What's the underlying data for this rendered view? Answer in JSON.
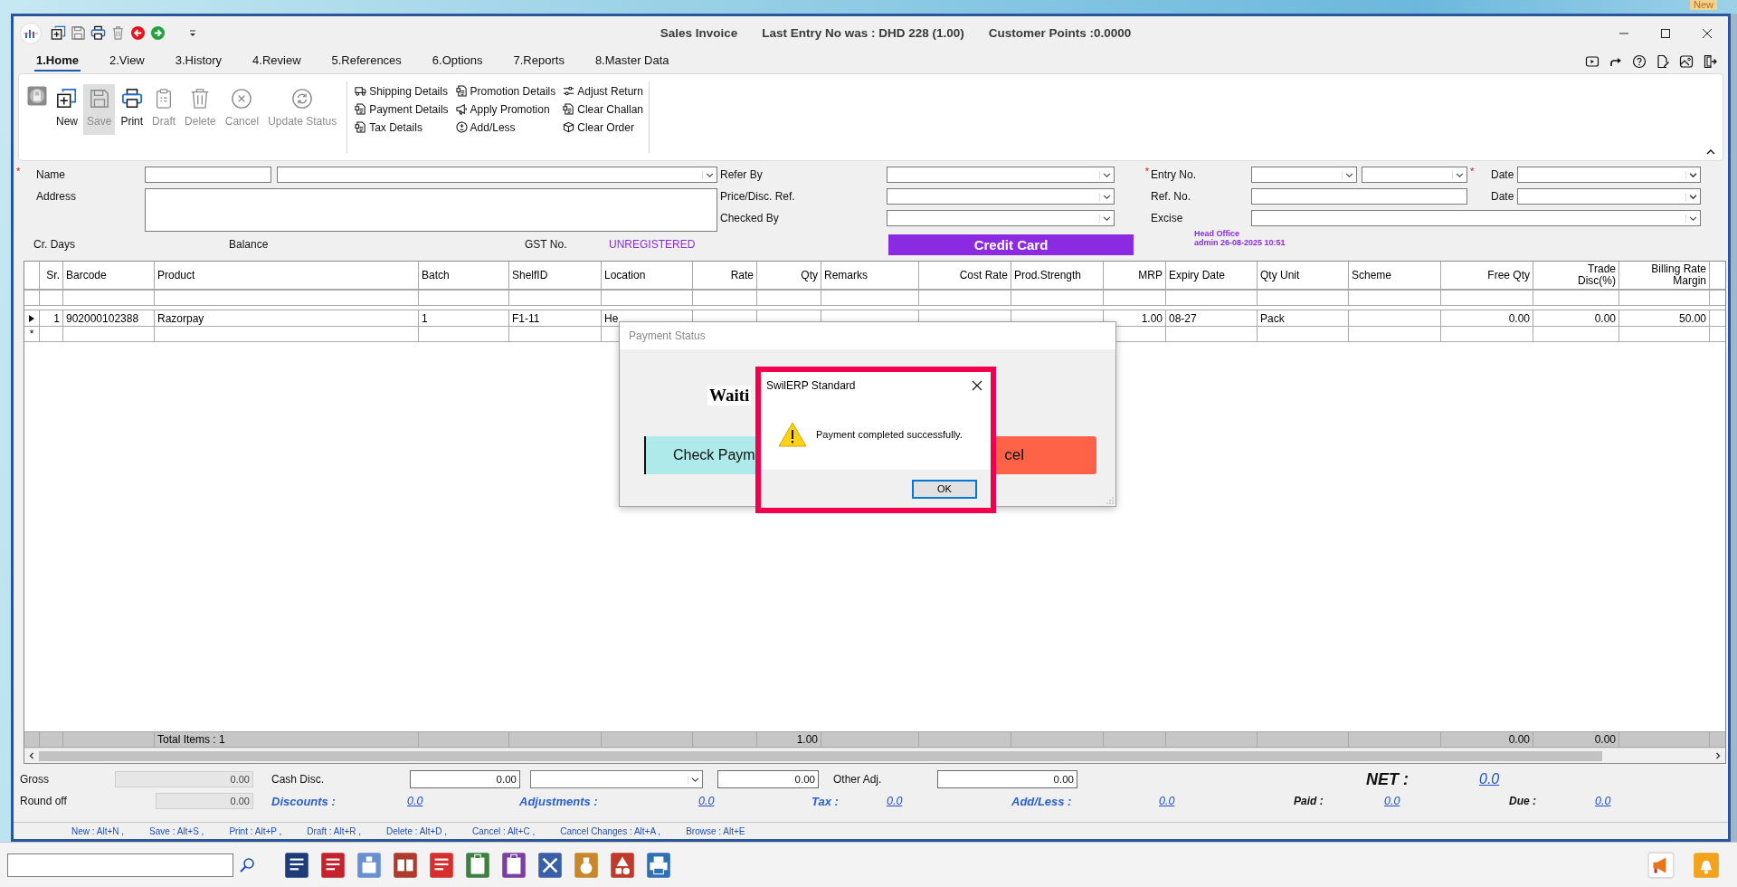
{
  "desktop": {
    "badge": "New"
  },
  "window": {
    "title": "Sales Invoice",
    "last_entry": "Last Entry No was : DHD 228 (1.00)",
    "customer_points": "Customer Points :0.0000"
  },
  "tabs": [
    {
      "label": "1.Home",
      "selected": true
    },
    {
      "label": "2.View",
      "selected": false
    },
    {
      "label": "3.History",
      "selected": false
    },
    {
      "label": "4.Review",
      "selected": false
    },
    {
      "label": "5.References",
      "selected": false
    },
    {
      "label": "6.Options",
      "selected": false
    },
    {
      "label": "7.Reports",
      "selected": false
    },
    {
      "label": "8.Master Data",
      "selected": false
    }
  ],
  "ribbon": {
    "actions": [
      {
        "kind": "new",
        "label": "New",
        "disabled": false,
        "highlighted": false
      },
      {
        "kind": "save",
        "label": "Save",
        "disabled": true,
        "highlighted": true
      },
      {
        "kind": "print",
        "label": "Print",
        "disabled": false,
        "highlighted": false
      },
      {
        "kind": "draft",
        "label": "Draft",
        "disabled": true,
        "highlighted": false
      },
      {
        "kind": "delete",
        "label": "Delete",
        "disabled": true,
        "highlighted": false
      },
      {
        "kind": "cancel",
        "label": "Cancel",
        "disabled": true,
        "highlighted": false
      },
      {
        "kind": "update",
        "label": "Update Status",
        "disabled": true,
        "highlighted": false
      }
    ],
    "links": [
      [
        {
          "kind": "truck",
          "label": "Shipping Details"
        },
        {
          "kind": "receipt",
          "label": "Payment Details"
        },
        {
          "kind": "receipt",
          "label": "Tax Details"
        }
      ],
      [
        {
          "kind": "receipt",
          "label": "Promotion Details"
        },
        {
          "kind": "megaphone",
          "label": "Apply Promotion"
        },
        {
          "kind": "plusminus",
          "label": "Add/Less"
        }
      ],
      [
        {
          "kind": "sliders",
          "label": "Adjust Return"
        },
        {
          "kind": "receipt",
          "label": "Clear Challan"
        },
        {
          "kind": "box",
          "label": "Clear Order"
        }
      ]
    ]
  },
  "form": {
    "name": {
      "label": "Name",
      "required_mark": "*"
    },
    "address": {
      "label": "Address"
    },
    "refer_by": {
      "label": "Refer By"
    },
    "price_ref": {
      "label": "Price/Disc. Ref."
    },
    "checked_by": {
      "label": "Checked By"
    },
    "entry_no": {
      "label": "Entry No.",
      "required_mark": "*"
    },
    "date": {
      "label": "Date",
      "required_mark": "*"
    },
    "ref_no": {
      "label": "Ref. No."
    },
    "ref_date": {
      "label": "Date"
    },
    "excise": {
      "label": "Excise"
    },
    "cr_days": {
      "label": "Cr. Days"
    },
    "balance": {
      "label": "Balance"
    },
    "gst": {
      "label": "GST No.",
      "value": "UNREGISTERED"
    },
    "payment_mode": "Credit Card",
    "branch": "Head Office",
    "stamp": "admin 26-08-2025 10:51"
  },
  "grid": {
    "columns": [
      "Sr.",
      "Barcode",
      "Product",
      "Batch",
      "ShelfID",
      "Location",
      "Rate",
      "Qty",
      "Remarks",
      "Cost Rate",
      "Prod.Strength",
      "MRP",
      "Expiry Date",
      "Qty Unit",
      "Scheme",
      "Free Qty",
      "Trade Disc(%)",
      "Billing Rate Margin"
    ],
    "rows": [
      {
        "current": true,
        "cells": [
          "1",
          "902000102388",
          "Razorpay",
          "1",
          "F1-11",
          "He",
          null,
          null,
          null,
          null,
          null,
          "1.00",
          "08-27",
          "Pack",
          null,
          "0.00",
          "0.00",
          "50.00"
        ]
      }
    ],
    "new_row_marker": "*",
    "totals": {
      "label": "Total Items : 1",
      "qty": "1.00",
      "free_qty": "0.00",
      "trade_disc": "0.00"
    }
  },
  "summary": {
    "gross": {
      "label": "Gross",
      "value": "0.00"
    },
    "round_off": {
      "label": "Round off",
      "value": "0.00"
    },
    "cash_disc": {
      "label": "Cash Disc.",
      "value": "0.00",
      "amount": "0.00"
    },
    "other_adj": {
      "label": "Other Adj.",
      "value": "0.00"
    },
    "net": {
      "label": "NET :",
      "value": "0.0"
    },
    "discounts": {
      "label": "Discounts :",
      "value": "0.0"
    },
    "adjustments": {
      "label": "Adjustments :",
      "value": "0.0"
    },
    "tax": {
      "label": "Tax :",
      "value": "0.0"
    },
    "add_less": {
      "label": "Add/Less :",
      "value": "0.0"
    },
    "paid": {
      "label": "Paid :",
      "value": "0.0"
    },
    "due": {
      "label": "Due :",
      "value": "0.0"
    }
  },
  "shortcuts": [
    "New : Alt+N ,",
    "Save : Alt+S ,",
    "Print : Alt+P ,",
    "Draft : Alt+R ,",
    "Delete : Alt+D ,",
    "Cancel : Alt+C ,",
    "Cancel Changes : Alt+A ,",
    "Browse : Alt+E"
  ],
  "payment_dialog": {
    "title": "Payment Status",
    "message": "Waiti",
    "check_button": "Check Paym",
    "cancel_button": "cel"
  },
  "message_box": {
    "title": "SwilERP Standard",
    "text": "Payment completed successfully.",
    "ok_button": "OK",
    "highlighted": true
  }
}
